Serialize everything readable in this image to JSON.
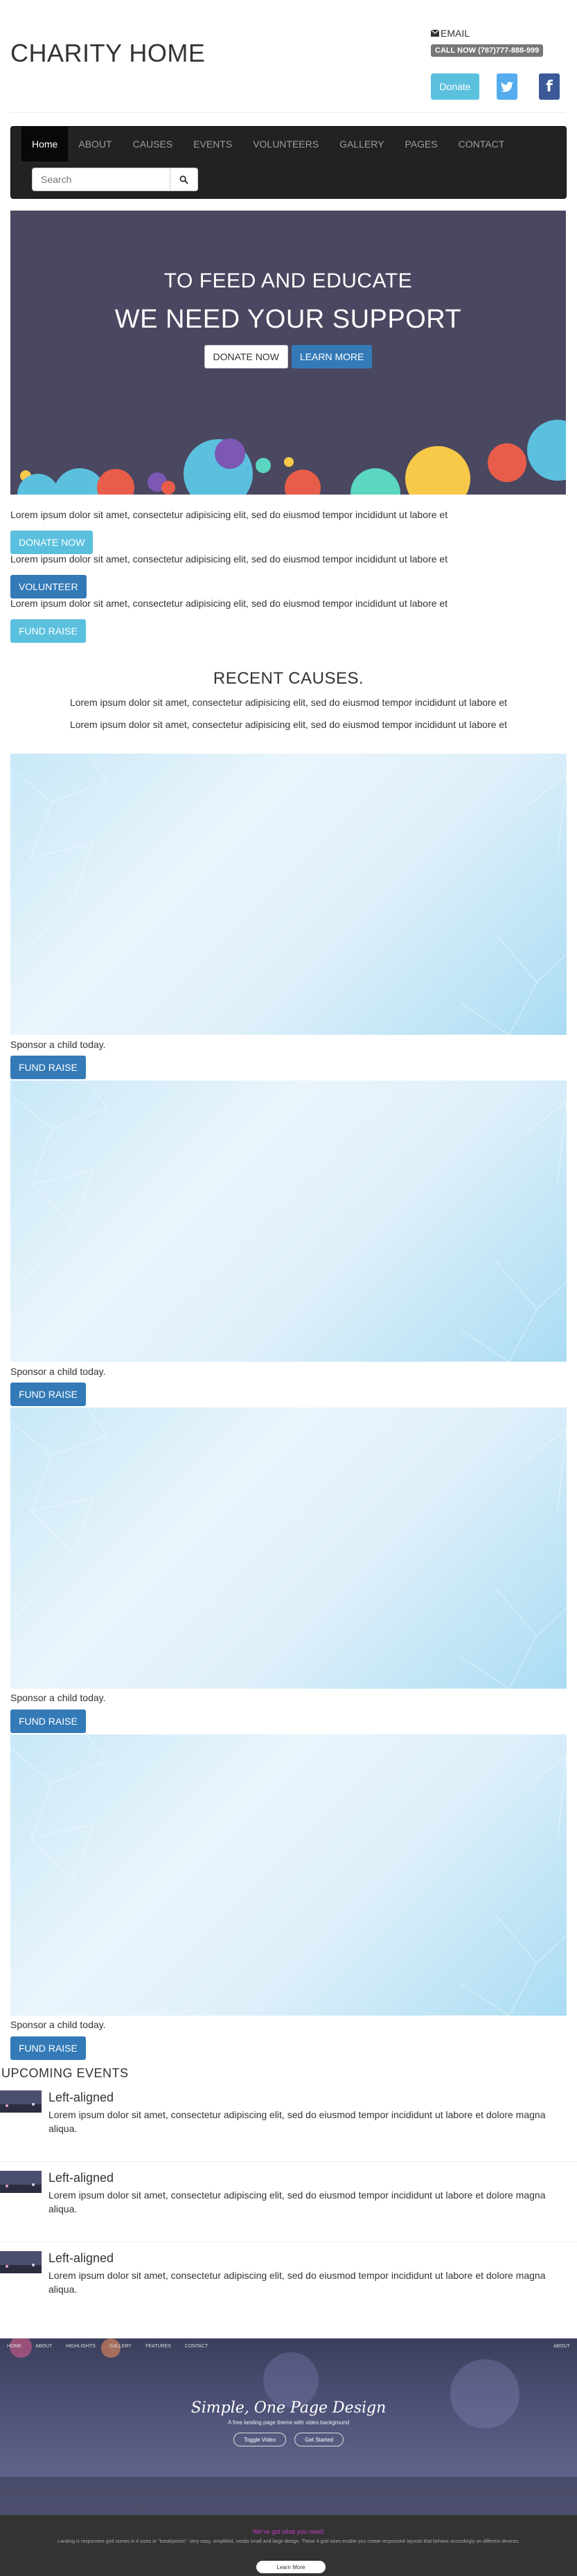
{
  "header": {
    "site_title": "CHARITY HOME",
    "email_label": "EMAIL",
    "call_label": "CALL NOW (787)777-888-999",
    "donate_label": "Donate",
    "twitter_icon": "twitter-icon",
    "facebook_icon": "facebook-icon"
  },
  "nav": {
    "items": [
      "Home",
      "ABOUT",
      "CAUSES",
      "EVENTS",
      "VOLUNTEERS",
      "GALLERY",
      "PAGES",
      "CONTACT"
    ],
    "active": "Home",
    "search_placeholder": "Search"
  },
  "hero": {
    "subtitle": "TO FEED AND EDUCATE",
    "title": "WE NEED YOUR SUPPORT",
    "donate_label": "DONATE NOW",
    "learn_label": "LEARN MORE",
    "background_color": "#4a4760"
  },
  "intro": {
    "text": "Lorem ipsum dolor sit amet, consectetur adipisicing elit, sed do eiusmod tempor incididunt ut labore et",
    "donate_label": "DONATE NOW",
    "volunteer_label": "VOLUNTEER",
    "fundraise_label": "FUND RAISE"
  },
  "causes": {
    "title": "RECENT CAUSES.",
    "line1": "Lorem ipsum dolor sit amet, consectetur adipisicing elit, sed do eiusmod tempor incididunt ut labore et",
    "line2": "Lorem ipsum dolor sit amet, consectetur adipisicing elit, sed do eiusmod tempor incididunt ut labore et",
    "cards": [
      {
        "caption": "Sponsor a child today.",
        "button": "FUND RAISE"
      },
      {
        "caption": "Sponsor a child today.",
        "button": "FUND RAISE"
      },
      {
        "caption": "Sponsor a child today.",
        "button": "FUND RAISE"
      },
      {
        "caption": "Sponsor a child today.",
        "button": "FUND RAISE"
      }
    ]
  },
  "events": {
    "title": "UPCOMING EVENTS",
    "items": [
      {
        "heading": "Left-aligned",
        "body": "Lorem ipsum dolor sit amet, consectetur adipiscing elit, sed do eiusmod tempor incididunt ut labore et dolore magna aliqua."
      },
      {
        "heading": "Left-aligned",
        "body": "Lorem ipsum dolor sit amet, consectetur adipiscing elit, sed do eiusmod tempor incididunt ut labore et dolore magna aliqua."
      },
      {
        "heading": "Left-aligned",
        "body": "Lorem ipsum dolor sit amet, consectetur adipiscing elit, sed do eiusmod tempor incididunt ut labore et dolore magna aliqua."
      }
    ]
  },
  "showcase": {
    "nav": [
      "HOME",
      "ABOUT",
      "HIGHLIGHTS",
      "GALLERY",
      "FEATURES",
      "CONTACT"
    ],
    "nav_right": "ABOUT",
    "title": "Simple, One Page Design",
    "subtitle": "A free landing page theme with video background",
    "btn_video": "Toggle Video",
    "btn_start": "Get Started",
    "bottom_title": "We've got what you need!",
    "bottom_text": "Landing is responsive grid comes in 4 sizes or \"breakpoints\". Very easy, simplified, media small and large design. These 4 grid sizes enable you create responsive layouts that behave accordingly on different devices.",
    "learn_label": "Learn More",
    "accent_color": "#c13bc1"
  }
}
